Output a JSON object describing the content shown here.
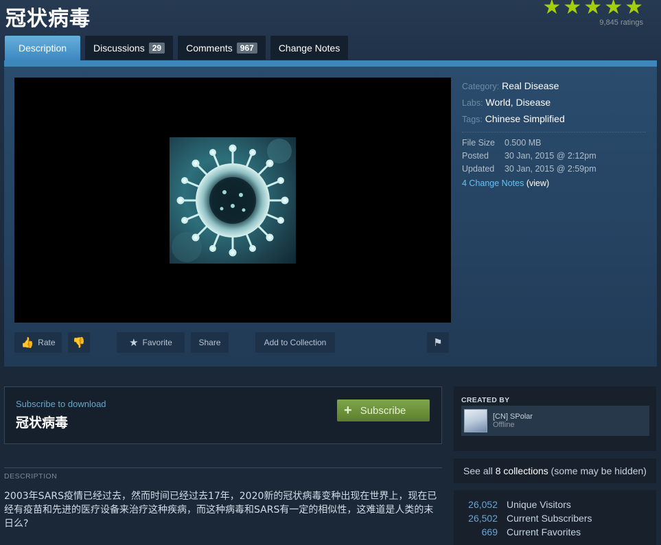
{
  "page": {
    "title": "冠状病毒"
  },
  "rating": {
    "stars": 5,
    "count": "9,845 ratings"
  },
  "tabs": [
    {
      "label": "Description",
      "active": true
    },
    {
      "label": "Discussions",
      "badge": "29"
    },
    {
      "label": "Comments",
      "badge": "967"
    },
    {
      "label": "Change Notes"
    }
  ],
  "actions": {
    "rate": "Rate",
    "favorite": "Favorite",
    "share": "Share",
    "add_to_collection": "Add to Collection"
  },
  "meta": {
    "category_label": "Category:",
    "category_value": "Real Disease",
    "labs_label": "Labs:",
    "labs_value_1": "World",
    "labs_sep": ",",
    "labs_value_2": "Disease",
    "tags_label": "Tags:",
    "tags_value": "Chinese Simplified",
    "file_size_label": "File Size",
    "file_size_value": "0.500 MB",
    "posted_label": "Posted",
    "posted_value": "30 Jan, 2015 @ 2:12pm",
    "updated_label": "Updated",
    "updated_value": "30 Jan, 2015 @ 2:59pm",
    "change_notes_link": "4 Change Notes",
    "view_open": "(",
    "view_label": "view",
    "view_close": ")"
  },
  "subscribe": {
    "label": "Subscribe to download",
    "title": "冠状病毒",
    "button": "Subscribe"
  },
  "description": {
    "heading": "DESCRIPTION",
    "text": "2003年SARS疫情已经过去，然而时间已经过去17年，2020新的冠状病毒变种出现在世界上，现在已经有疫苗和先进的医疗设备来治疗这种疾病，而这种病毒和SARS有一定的相似性，这难道是人类的末日么?"
  },
  "creator": {
    "heading": "CREATED BY",
    "name": "[CN] SPolar",
    "status": "Offline"
  },
  "collections": {
    "prefix": "See all",
    "count": "8",
    "suffix": "collections",
    "note": "(some may be hidden)"
  },
  "stats": [
    {
      "value": "26,052",
      "label": "Unique Visitors"
    },
    {
      "value": "26,502",
      "label": "Current Subscribers"
    },
    {
      "value": "669",
      "label": "Current Favorites"
    }
  ],
  "colors": {
    "background": "#1b2838",
    "accent_blue": "#67c1f5",
    "star_green": "#a4d007",
    "subscribe_green": "#6c8e3a"
  }
}
